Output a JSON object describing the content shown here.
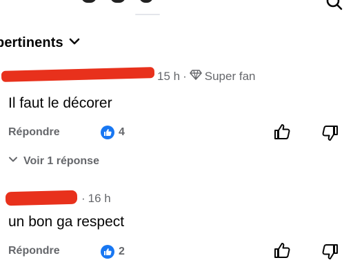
{
  "header": {
    "filter_label": "pertinents"
  },
  "comments": [
    {
      "time": "15 h",
      "separator": "·",
      "badge": "Super fan",
      "text": "Il faut le décorer",
      "reply_label": "Répondre",
      "like_count": "4",
      "view_replies": "Voir 1 réponse"
    },
    {
      "time": "16 h",
      "separator": "·",
      "text": "un bon ga respect",
      "reply_label": "Répondre",
      "like_count": "2"
    }
  ],
  "icons": {
    "filter": "chevron-down-icon",
    "badge": "diamond-icon",
    "like": "thumbs-up-icon",
    "dislike": "thumbs-down-icon",
    "search": "search-icon"
  },
  "colors": {
    "accent": "#1877f2",
    "secondary_text": "#65676b",
    "redaction": "#e8311c"
  }
}
